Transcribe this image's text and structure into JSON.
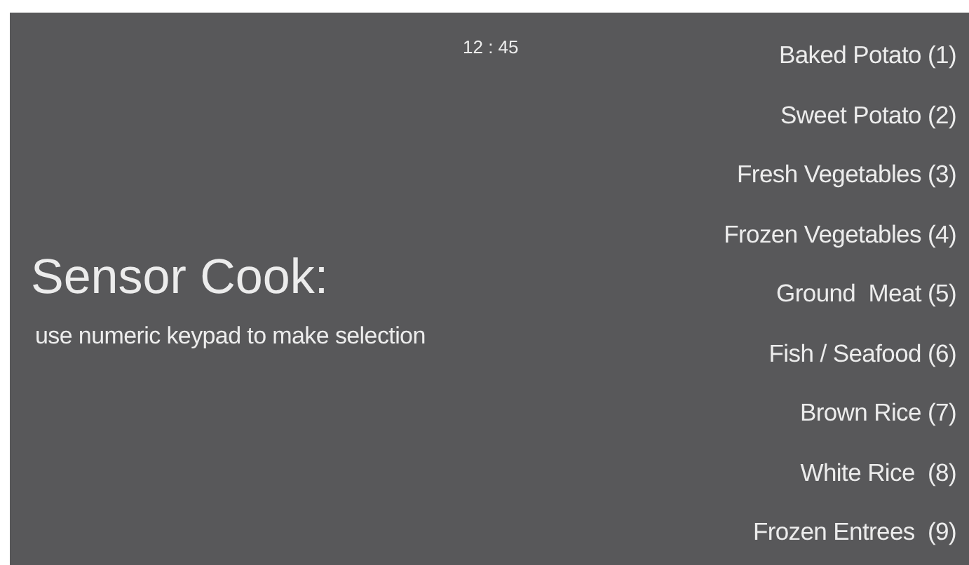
{
  "clock": "12 : 45",
  "title": "Sensor Cook:",
  "instruction": "use numeric keypad to make selection",
  "menu_items": [
    "Baked Potato (1)",
    "Sweet Potato (2)",
    "Fresh Vegetables (3)",
    "Frozen Vegetables (4)",
    "Ground  Meat (5)",
    "Fish / Seafood (6)",
    "Brown Rice (7)",
    "White Rice  (8)",
    "Frozen Entrees  (9)"
  ]
}
